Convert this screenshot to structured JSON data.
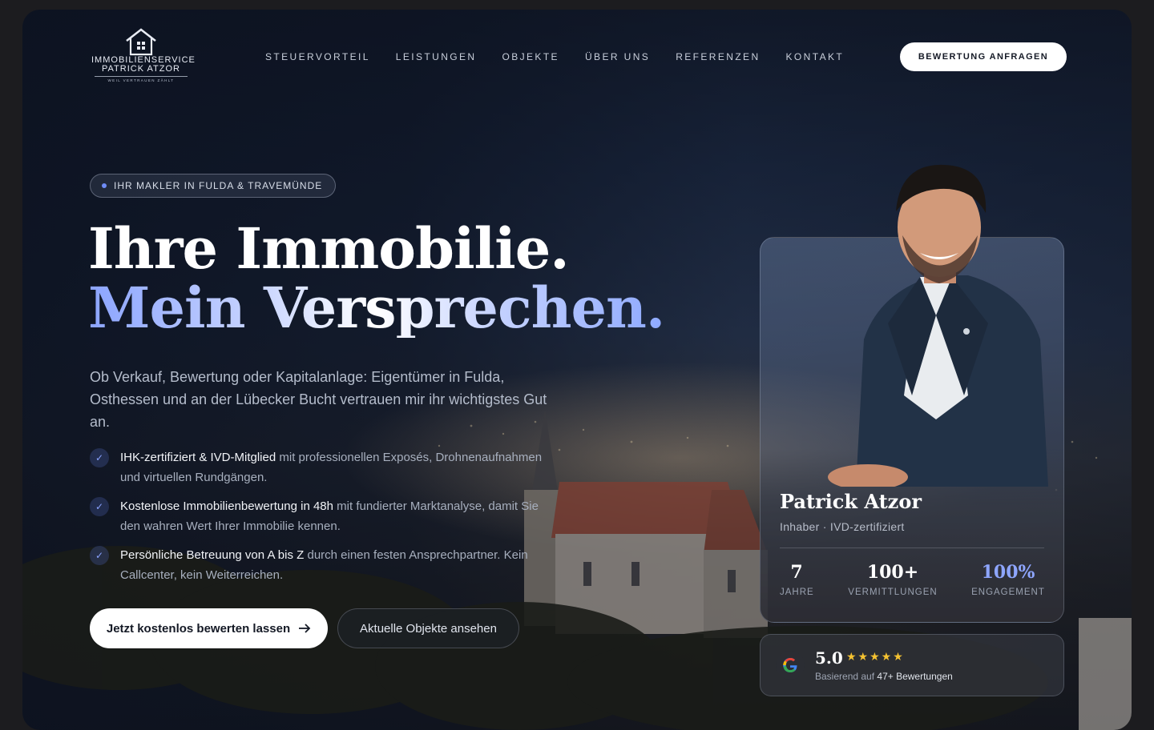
{
  "brand": {
    "line1": "IMMOBILIENSERVICE",
    "line2": "PATRICK ATZOR",
    "tagline": "WEIL VERTRAUEN ZÄHLT"
  },
  "nav": {
    "items": [
      {
        "label": "STEUERVORTEIL"
      },
      {
        "label": "LEISTUNGEN"
      },
      {
        "label": "OBJEKTE"
      },
      {
        "label": "ÜBER UNS"
      },
      {
        "label": "REFERENZEN"
      },
      {
        "label": "KONTAKT"
      }
    ],
    "cta_label": "BEWERTUNG ANFRAGEN"
  },
  "hero": {
    "badge": "IHR MAKLER IN FULDA & TRAVEMÜNDE",
    "headline_line1": "Ihre Immobilie.",
    "headline_line2": "Mein Versprechen.",
    "lead": "Ob Verkauf, Bewertung oder Kapitalanlage: Eigentümer in Fulda, Osthessen und an der Lübecker Bucht vertrauen mir ihr wichtigstes Gut an.",
    "features": [
      {
        "strong": "IHK-zertifiziert & IVD-Mitglied",
        "text": " mit professionellen Exposés, Drohnenaufnahmen und virtuellen Rundgängen."
      },
      {
        "strong": "Kostenlose Immobilienbewertung in 48h",
        "text": " mit fundierter Marktanalyse, damit Sie den wahren Wert Ihrer Immobilie kennen."
      },
      {
        "strong": "Persönliche Betreuung von A bis Z",
        "text": " durch einen festen Ansprechpartner. Kein Callcenter, kein Weiterreichen."
      }
    ],
    "primary_button": "Jetzt kostenlos bewerten lassen",
    "secondary_button": "Aktuelle Objekte ansehen"
  },
  "profile": {
    "name": "Patrick Atzor",
    "role": "Inhaber · IVD-zertifiziert",
    "stats": [
      {
        "value": "7",
        "label": "JAHRE"
      },
      {
        "value": "100+",
        "label": "VERMITTLUNGEN"
      },
      {
        "value": "100%",
        "label": "ENGAGEMENT"
      }
    ]
  },
  "review": {
    "rating": "5.0",
    "stars": "★★★★★",
    "prefix": "Basierend auf ",
    "count": "47+ Bewertungen"
  },
  "icons": [
    "house-logo-icon",
    "check-icon",
    "arrow-right-icon",
    "google-icon",
    "star-icon"
  ],
  "colors": {
    "accent": "#8ba4ff",
    "star": "#f6c331",
    "background": "#131b2c"
  }
}
